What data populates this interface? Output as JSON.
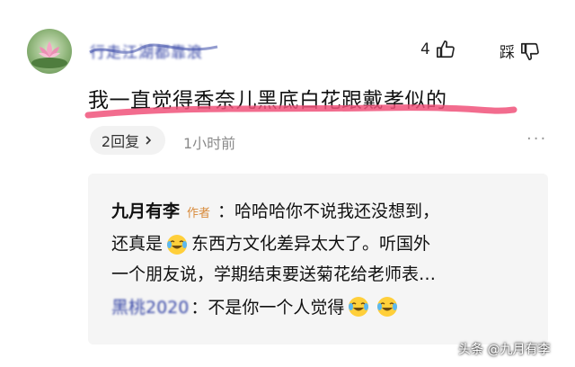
{
  "top_comment": {
    "username": "行走江湖都靠浪",
    "like_count": "4",
    "dislike_label": "踩",
    "text": "我一直觉得香奈儿黑底白花跟戴孝似的",
    "reply_button_label": "2回复",
    "time": "1小时前",
    "more_label": "···"
  },
  "reply": {
    "author_name": "九月有李",
    "author_tag": "作者",
    "line1": "：哈哈哈你不说我还没想到，",
    "line2_prefix": "还真是",
    "line2_suffix": "东西方文化差异太大了。听国外",
    "line3": "一个朋友说，学期结束要送菊花给老师表…",
    "sub_user": "黑桃2020",
    "sub_text": "：不是你一个人觉得"
  },
  "watermark": "头条 @九月有李",
  "colors": {
    "pink_stroke": "#f0527a",
    "username": "#3b4aa8",
    "author_tag": "#d88a3a"
  },
  "icons": [
    "thumbs-up-icon",
    "thumbs-down-icon",
    "chevron-right-icon",
    "laughing-cry-emoji"
  ]
}
